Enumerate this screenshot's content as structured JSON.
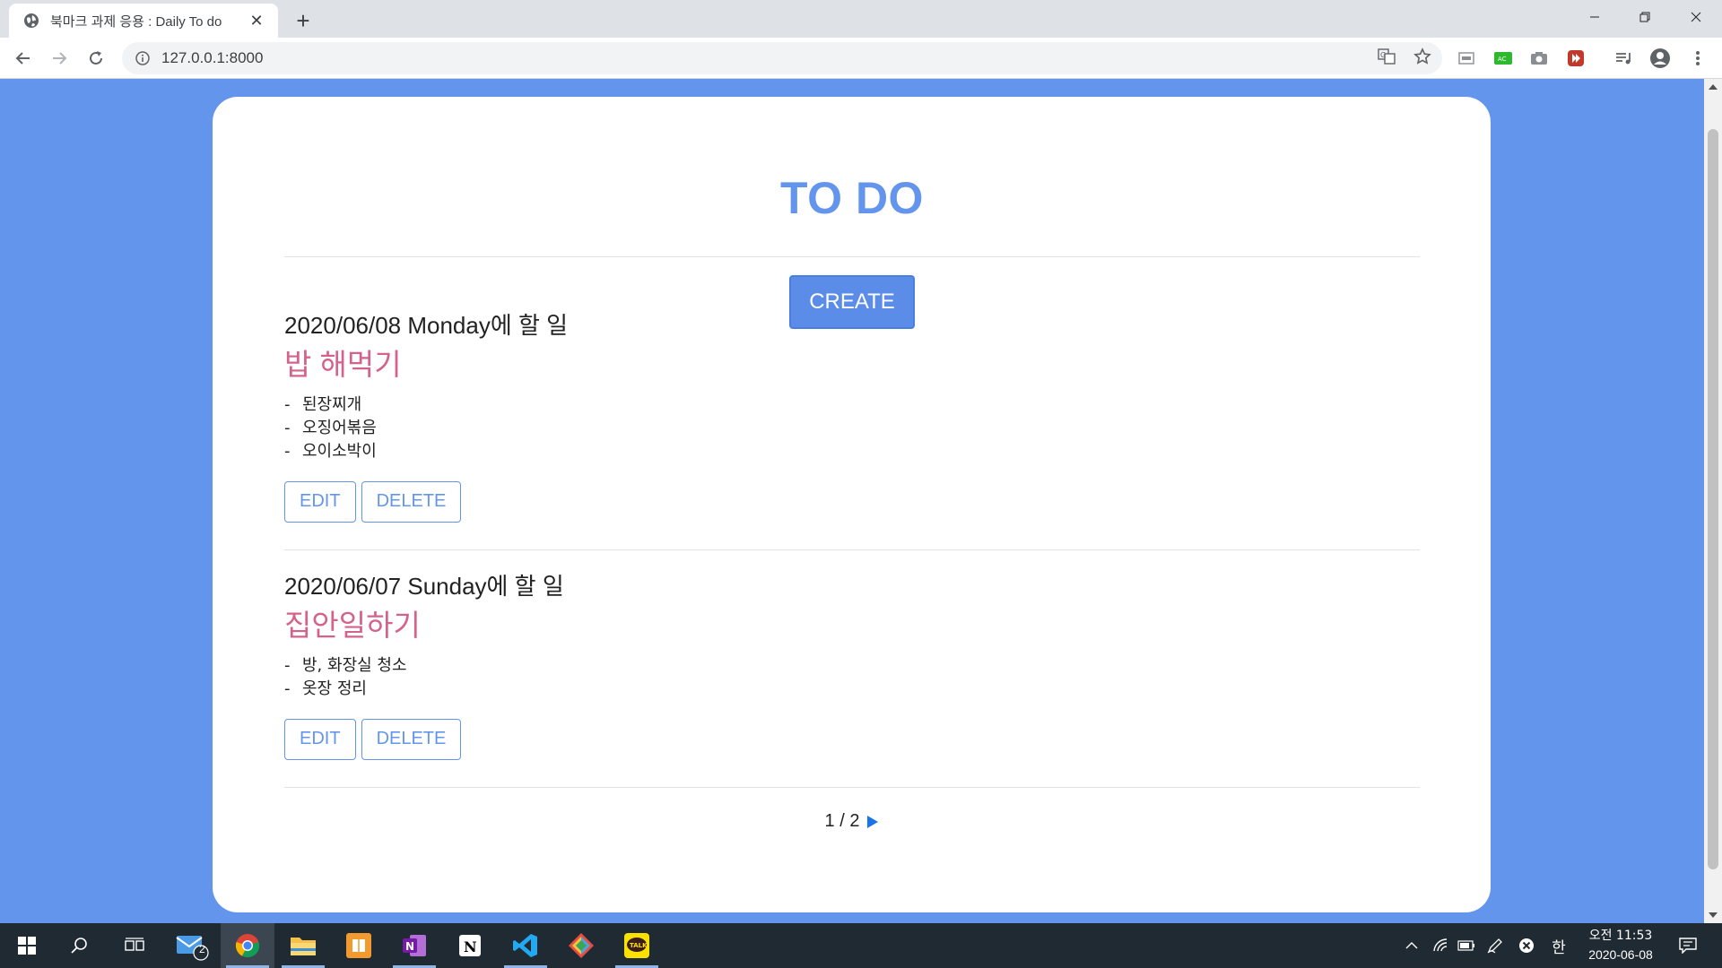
{
  "browser": {
    "tab_title": "북마크 과제 응용 : Daily To do",
    "url": "127.0.0.1:8000"
  },
  "page": {
    "title": "TO DO",
    "create_label": "CREATE",
    "todos": [
      {
        "date": "2020/06/08 Monday에 할 일",
        "name": "밥 해먹기",
        "items": [
          "된장찌개",
          "오징어볶음",
          "오이소박이"
        ],
        "edit_label": "EDIT",
        "delete_label": "DELETE"
      },
      {
        "date": "2020/06/07 Sunday에 할 일",
        "name": "집안일하기",
        "items": [
          "방, 화장실 청소",
          "옷장 정리"
        ],
        "edit_label": "EDIT",
        "delete_label": "DELETE"
      }
    ],
    "pagination": "1 / 2"
  },
  "taskbar": {
    "mail_badge": "2",
    "ime": "한",
    "clock_time": "오전 11:53",
    "clock_date": "2020-06-08"
  },
  "colors": {
    "page_background": "#6495ed",
    "title": "#6495ed",
    "todo_name": "#d4628a",
    "button_primary": "#5b8de8"
  }
}
